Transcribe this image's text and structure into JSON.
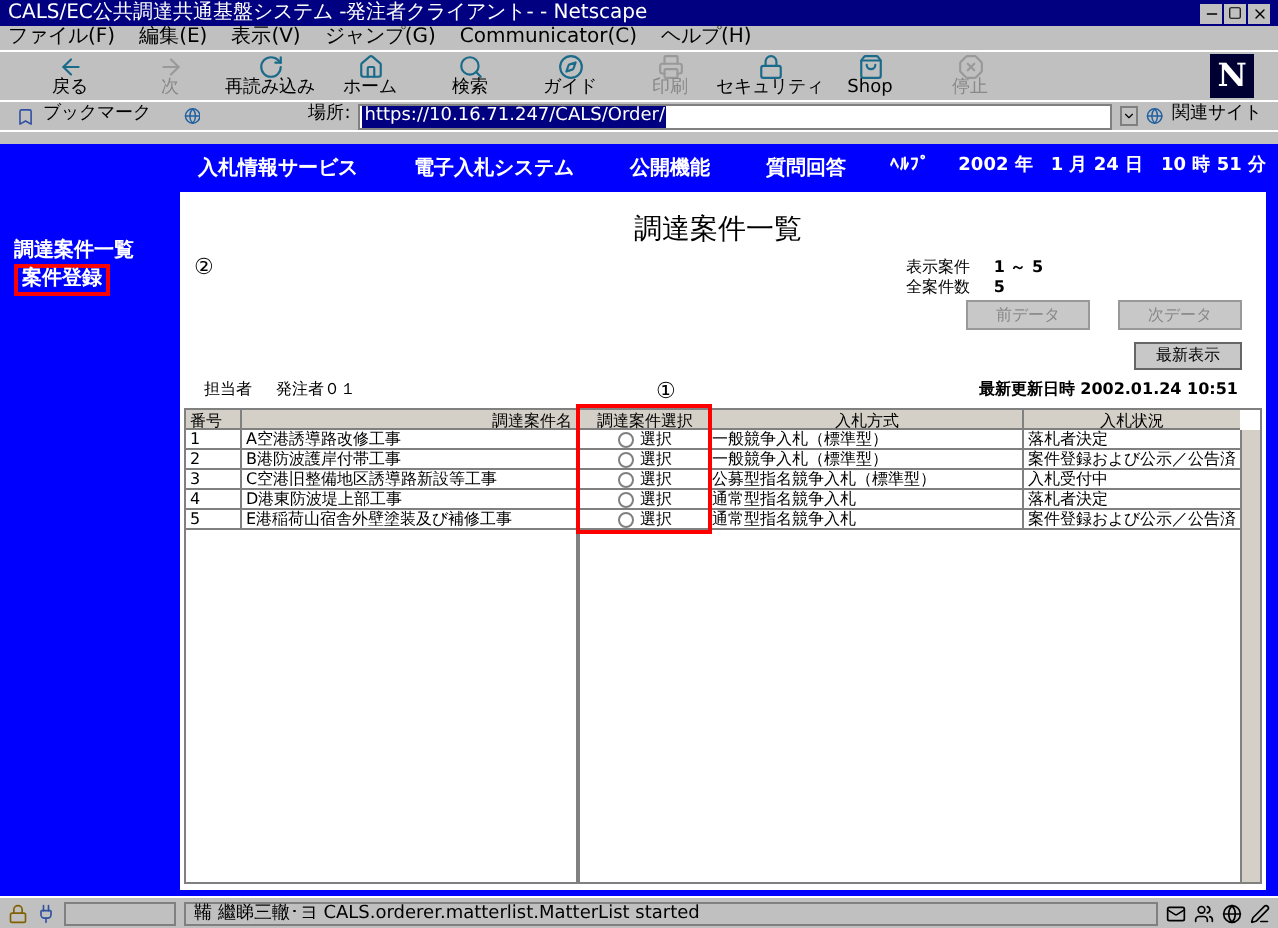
{
  "window": {
    "title": "CALS/EC公共調達共通基盤システム -発注者クライアント- - Netscape"
  },
  "menu": [
    "ファイル(F)",
    "編集(E)",
    "表示(V)",
    "ジャンプ(G)",
    "Communicator(C)",
    "ヘルプ(H)"
  ],
  "toolbar": [
    {
      "label": "戻る",
      "kind": "back",
      "disabled": false
    },
    {
      "label": "次",
      "kind": "forward",
      "disabled": true
    },
    {
      "label": "再読み込み",
      "kind": "reload",
      "disabled": false
    },
    {
      "label": "ホーム",
      "kind": "home",
      "disabled": false
    },
    {
      "label": "検索",
      "kind": "search",
      "disabled": false
    },
    {
      "label": "ガイド",
      "kind": "guide",
      "disabled": false
    },
    {
      "label": "印刷",
      "kind": "print",
      "disabled": true
    },
    {
      "label": "セキュリティ",
      "kind": "security",
      "disabled": false
    },
    {
      "label": "Shop",
      "kind": "shop",
      "disabled": false
    },
    {
      "label": "停止",
      "kind": "stop",
      "disabled": true
    }
  ],
  "logo": "N",
  "location_bar": {
    "bookmarks": "ブックマーク",
    "label": "場所:",
    "url": "https://10.16.71.247/CALS/Order/",
    "related": "関連サイト"
  },
  "sidebar": {
    "items": [
      {
        "label": "調達案件一覧",
        "selected": false
      },
      {
        "label": "案件登録",
        "selected": true
      }
    ]
  },
  "nav": {
    "items": [
      "入札情報サービス",
      "電子入札システム",
      "公開機能",
      "質問回答"
    ],
    "help": "ﾍﾙﾌﾟ",
    "datetime": "2002 年　1 月 24 日　10 時 51 分"
  },
  "page": {
    "title": "調達案件一覧",
    "marker_2": "②",
    "marker_1": "①",
    "summary": [
      {
        "label": "表示案件",
        "value": "1 ～ 5"
      },
      {
        "label": "全案件数",
        "value": "5"
      }
    ],
    "paging": [
      {
        "label": "前データ",
        "disabled": true
      },
      {
        "label": "次データ",
        "disabled": true
      }
    ],
    "refresh": "最新表示",
    "owner_label": "担当者",
    "owner": "発注者０１",
    "updated": "最新更新日時 2002.01.24 10:51"
  },
  "table": {
    "columns": [
      "番号",
      "調達案件名",
      "調達案件選択",
      "入札方式",
      "入札状況"
    ],
    "rows": [
      {
        "no": "1",
        "name": "A空港誘導路改修工事",
        "selected": false,
        "choice": "選択",
        "method": "一般競争入札（標準型）",
        "status": "落札者決定"
      },
      {
        "no": "2",
        "name": "B港防波護岸付帯工事",
        "selected": false,
        "choice": "選択",
        "method": "一般競争入札（標準型）",
        "status": "案件登録および公示／公告済"
      },
      {
        "no": "3",
        "name": "C空港旧整備地区誘導路新設等工事",
        "selected": false,
        "choice": "選択",
        "method": "公募型指名競争入札（標準型）",
        "status": "入札受付中"
      },
      {
        "no": "4",
        "name": "D港東防波堤上部工事",
        "selected": false,
        "choice": "選択",
        "method": "通常型指名競争入札",
        "status": "落札者決定"
      },
      {
        "no": "5",
        "name": "E港稲荷山宿舎外壁塗装及び補修工事",
        "selected": false,
        "choice": "選択",
        "method": "通常型指名競争入札",
        "status": "案件登録および公示／公告済"
      }
    ]
  },
  "status_bar": {
    "text": "鞴 繼睇三轍･ヨ CALS.orderer.matterlist.MatterList started"
  }
}
